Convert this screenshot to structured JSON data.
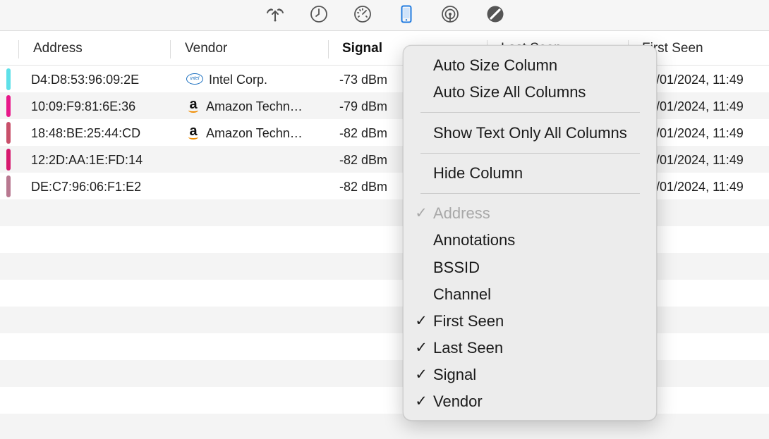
{
  "toolbar": {
    "icons": [
      {
        "name": "wifi-icon",
        "active": false
      },
      {
        "name": "clock-icon",
        "active": false
      },
      {
        "name": "gauge-icon",
        "active": false
      },
      {
        "name": "phone-icon",
        "active": true
      },
      {
        "name": "broadcast-icon",
        "active": false
      },
      {
        "name": "no-entry-icon",
        "active": false
      }
    ]
  },
  "colors": {
    "accent": "#1f7ae0",
    "row_alt": "#f4f4f4"
  },
  "table": {
    "columns": [
      "Address",
      "Vendor",
      "Signal",
      "Last Seen",
      "First Seen"
    ],
    "sorted_column": "Signal",
    "rows": [
      {
        "tag_color": "#5ee0e8",
        "address": "D4:D8:53:96:09:2E",
        "vendor_icon": "intel-icon",
        "vendor": "Intel Corp.",
        "signal": "-73 dBm",
        "first_seen": "/01/2024, 11:49"
      },
      {
        "tag_color": "#e8188a",
        "address": "10:09:F9:81:6E:36",
        "vendor_icon": "amazon-icon",
        "vendor": "Amazon Techn…",
        "signal": "-79 dBm",
        "first_seen": "/01/2024, 11:49"
      },
      {
        "tag_color": "#c8506a",
        "address": "18:48:BE:25:44:CD",
        "vendor_icon": "amazon-icon",
        "vendor": "Amazon Techn…",
        "signal": "-82 dBm",
        "first_seen": "/01/2024, 11:49"
      },
      {
        "tag_color": "#d6186e",
        "address": "12:2D:AA:1E:FD:14",
        "vendor_icon": "",
        "vendor": "",
        "signal": "-82 dBm",
        "first_seen": "/01/2024, 11:49"
      },
      {
        "tag_color": "#b87890",
        "address": "DE:C7:96:06:F1:E2",
        "vendor_icon": "",
        "vendor": "",
        "signal": "-82 dBm",
        "first_seen": "/01/2024, 11:49"
      }
    ]
  },
  "context_menu": {
    "auto_size_column": "Auto Size Column",
    "auto_size_all_columns": "Auto Size All Columns",
    "show_text_only_all_columns": "Show Text Only All Columns",
    "hide_column": "Hide Column",
    "check_mark": "✓",
    "column_items": [
      {
        "label": "Address",
        "checked": true,
        "enabled": false
      },
      {
        "label": "Annotations",
        "checked": false,
        "enabled": true
      },
      {
        "label": "BSSID",
        "checked": false,
        "enabled": true
      },
      {
        "label": "Channel",
        "checked": false,
        "enabled": true
      },
      {
        "label": "First Seen",
        "checked": true,
        "enabled": true
      },
      {
        "label": "Last Seen",
        "checked": true,
        "enabled": true
      },
      {
        "label": "Signal",
        "checked": true,
        "enabled": true
      },
      {
        "label": "Vendor",
        "checked": true,
        "enabled": true
      }
    ]
  }
}
